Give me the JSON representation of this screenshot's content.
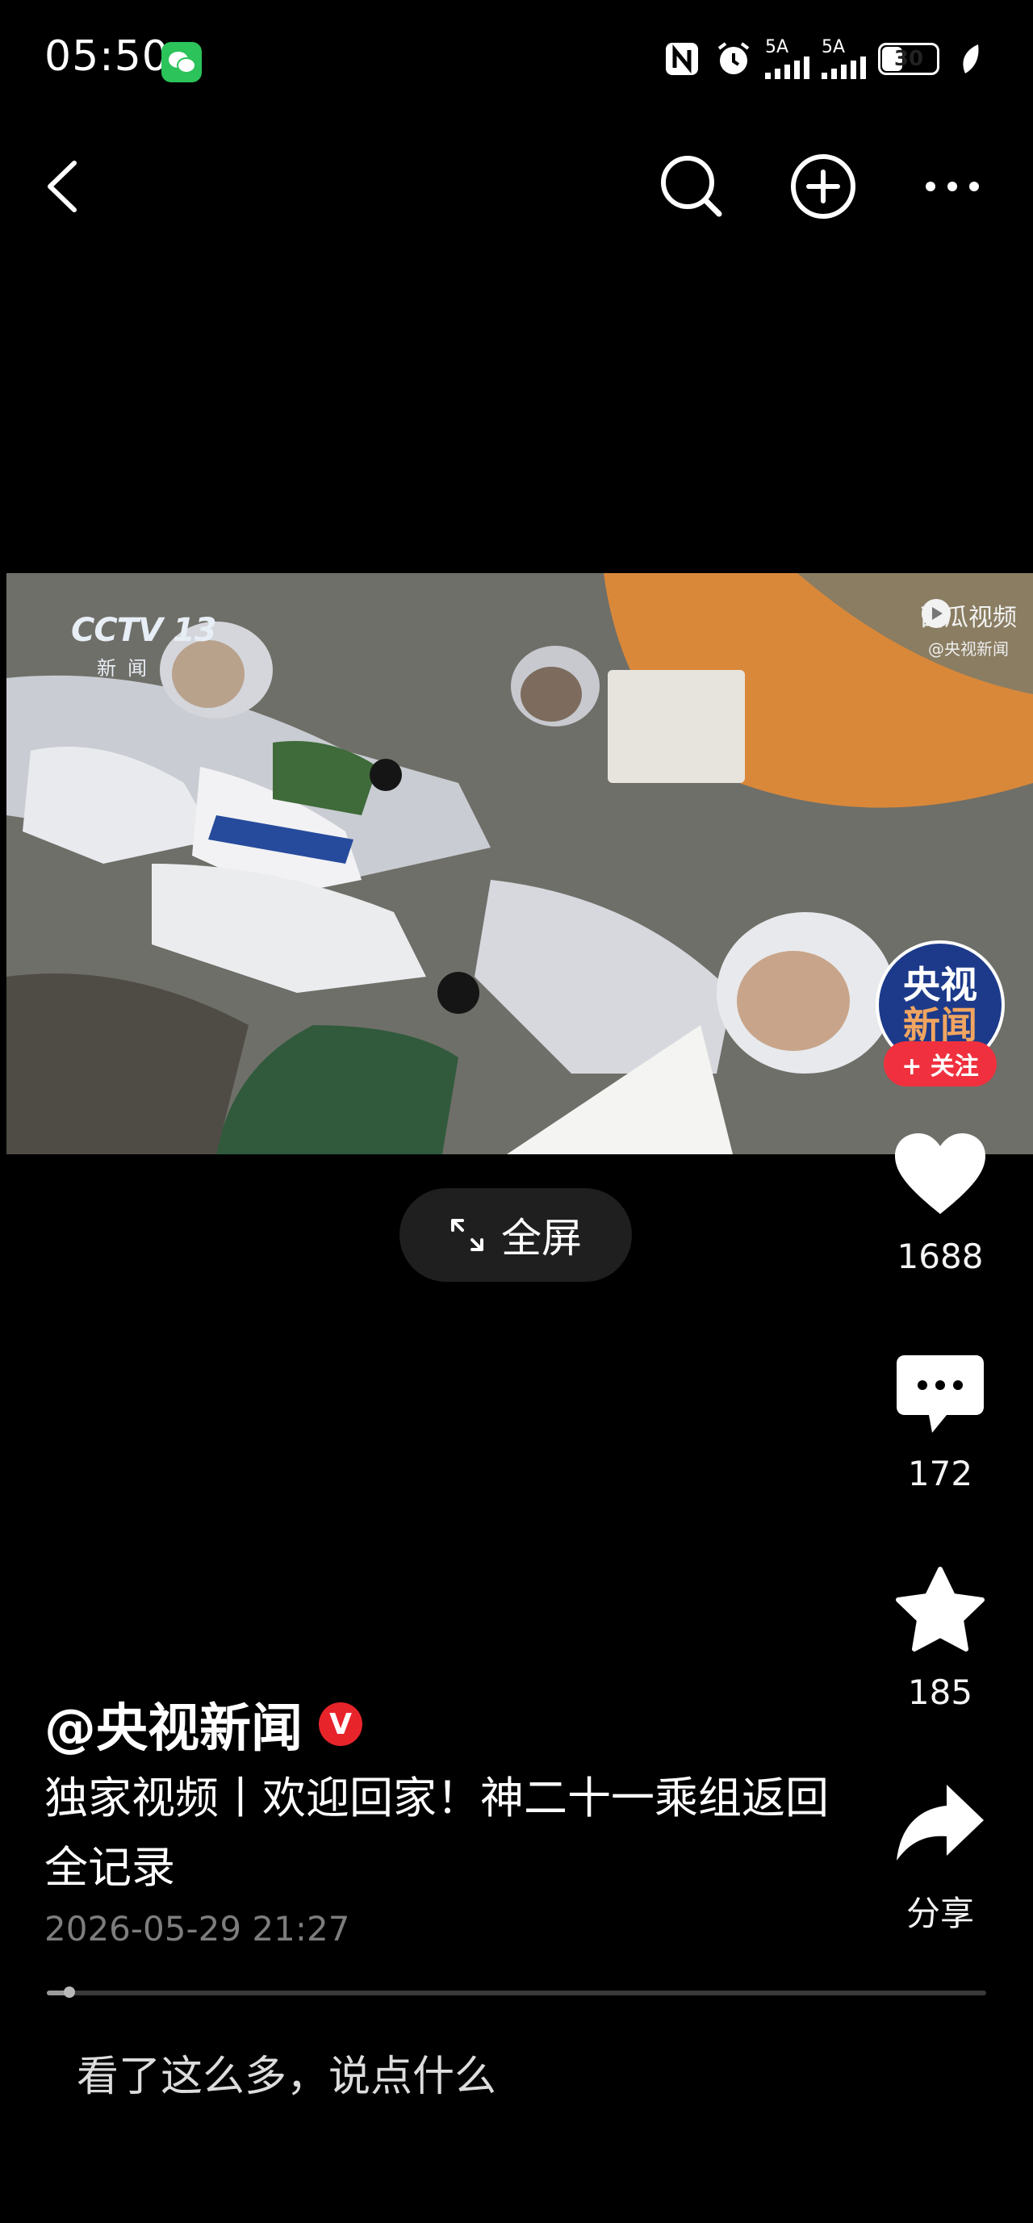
{
  "status_bar": {
    "time": "05:50",
    "signal1": "5A",
    "signal2": "5A",
    "battery": "30",
    "icons": [
      "wechat-icon",
      "nfc-icon",
      "alarm-icon",
      "signal-icon",
      "signal-icon",
      "battery-icon",
      "leaf-icon"
    ]
  },
  "nav": {
    "icons": [
      "back-icon",
      "search-icon",
      "add-circle-icon",
      "more-icon"
    ]
  },
  "video": {
    "channel_logo": "CCTV 13",
    "channel_sub": "新闻",
    "watermark": "西瓜视频",
    "watermark_sub": "@央视新闻",
    "avatar_line1": "央视",
    "avatar_line2": "新闻",
    "follow_label": "+ 关注"
  },
  "fullscreen_label": "全屏",
  "actions": {
    "like_count": "1688",
    "comment_count": "172",
    "favorite_count": "185",
    "share_label": "分享"
  },
  "post": {
    "author": "@央视新闻",
    "verified_badge": "V",
    "description": "独家视频丨欢迎回家！神二十一乘组返回全记录",
    "time": "2026-05-29 21:27"
  },
  "progress": {
    "played_fraction": 0.024
  },
  "comment": {
    "placeholder": "看了这么多，说点什么"
  },
  "colors": {
    "follow": "#f0303e",
    "verified": "#e8242b",
    "wechat": "#2bc35a"
  }
}
